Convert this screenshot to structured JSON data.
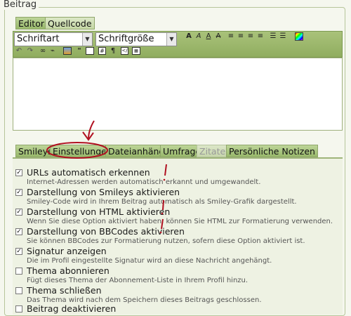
{
  "fieldset": {
    "legend": "Beitrag"
  },
  "mode_tabs": [
    {
      "label": "Editor"
    },
    {
      "label": "Quellcode"
    }
  ],
  "toolbar": {
    "font_select": "Schriftart",
    "size_select": "Schriftgröße"
  },
  "bottom_tabs": [
    {
      "label": "Smileys"
    },
    {
      "label": "Einstellungen"
    },
    {
      "label": "Dateianhänge"
    },
    {
      "label": "Umfrage"
    },
    {
      "label": "Zitate"
    },
    {
      "label": "Persönliche Notizen"
    }
  ],
  "options": [
    {
      "title": "URLs automatisch erkennen",
      "desc": "Internet-Adressen werden automatisch erkannt und umgewandelt.",
      "checked": true
    },
    {
      "title": "Darstellung von Smileys aktivieren",
      "desc": "Smiley-Code wird in Ihrem Beitrag automatisch als Smiley-Grafik dargestellt.",
      "checked": true
    },
    {
      "title": "Darstellung von HTML aktivieren",
      "desc": "Wenn Sie diese Option aktiviert haben, können Sie HTML zur Formatierung verwenden.",
      "checked": true
    },
    {
      "title": "Darstellung von BBCodes aktivieren",
      "desc": "Sie können BBCodes zur Formatierung nutzen, sofern diese Option aktiviert ist.",
      "checked": true
    },
    {
      "title": "Signatur anzeigen",
      "desc": "Die im Profil eingestellte Signatur wird an diese Nachricht angehängt.",
      "checked": true
    },
    {
      "title": "Thema abonnieren",
      "desc": "Fügt dieses Thema der Abonnement-Liste in Ihrem Profil hinzu.",
      "checked": false
    },
    {
      "title": "Thema schließen",
      "desc": "Das Thema wird nach dem Speichern dieses Beitrags geschlossen.",
      "checked": false
    },
    {
      "title": "Beitrag deaktivieren",
      "desc": "",
      "checked": false
    }
  ],
  "icons": {
    "checkmark": "✓"
  }
}
